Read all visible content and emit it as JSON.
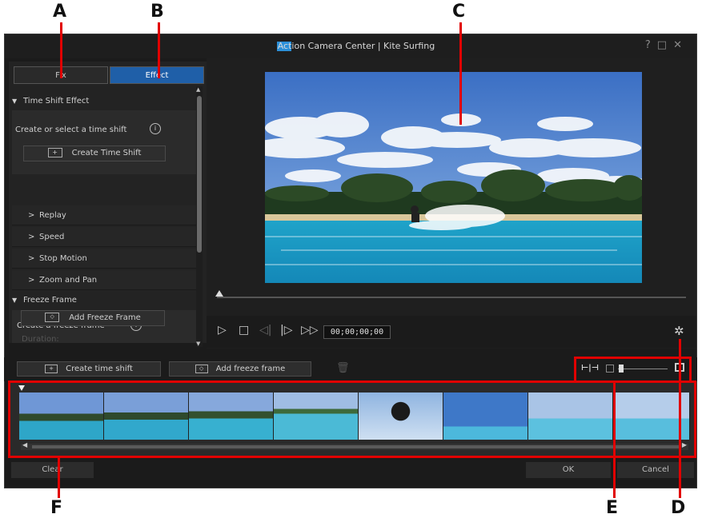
{
  "callouts": {
    "a": "A",
    "b": "B",
    "c": "C",
    "d": "D",
    "e": "E",
    "f": "F"
  },
  "window": {
    "title": "Action Camera Center | Kite Surfing",
    "help_icon": "?",
    "maximize_icon": "□",
    "close_icon": "✕"
  },
  "tabs": {
    "fix": "Fix",
    "effect": "Effect"
  },
  "time_shift": {
    "header": "Time Shift Effect",
    "prompt": "Create or select a time shift",
    "create_button": "Create Time Shift",
    "items": [
      "Replay",
      "Speed",
      "Stop Motion",
      "Zoom and Pan"
    ]
  },
  "freeze_frame": {
    "header": "Freeze Frame",
    "prompt": "Create a freeze frame",
    "add_button": "Add Freeze Frame",
    "duration_label": "Duration:"
  },
  "player": {
    "timecode": "00;00;00;00"
  },
  "toolbar": {
    "create_time_shift": "Create time shift",
    "add_freeze_frame": "Add freeze frame"
  },
  "footer": {
    "clear": "Clear",
    "ok": "OK",
    "cancel": "Cancel"
  },
  "colors": {
    "accent": "#1f5fa8",
    "annotation": "#e10000",
    "window_bg": "#1b1b1b"
  },
  "icons": [
    "brackets-plus-icon",
    "info-icon",
    "freeze-icon",
    "trash-icon",
    "settings-icon",
    "fit-timeline-icon",
    "zoom-out-icon",
    "zoom-in-icon"
  ]
}
